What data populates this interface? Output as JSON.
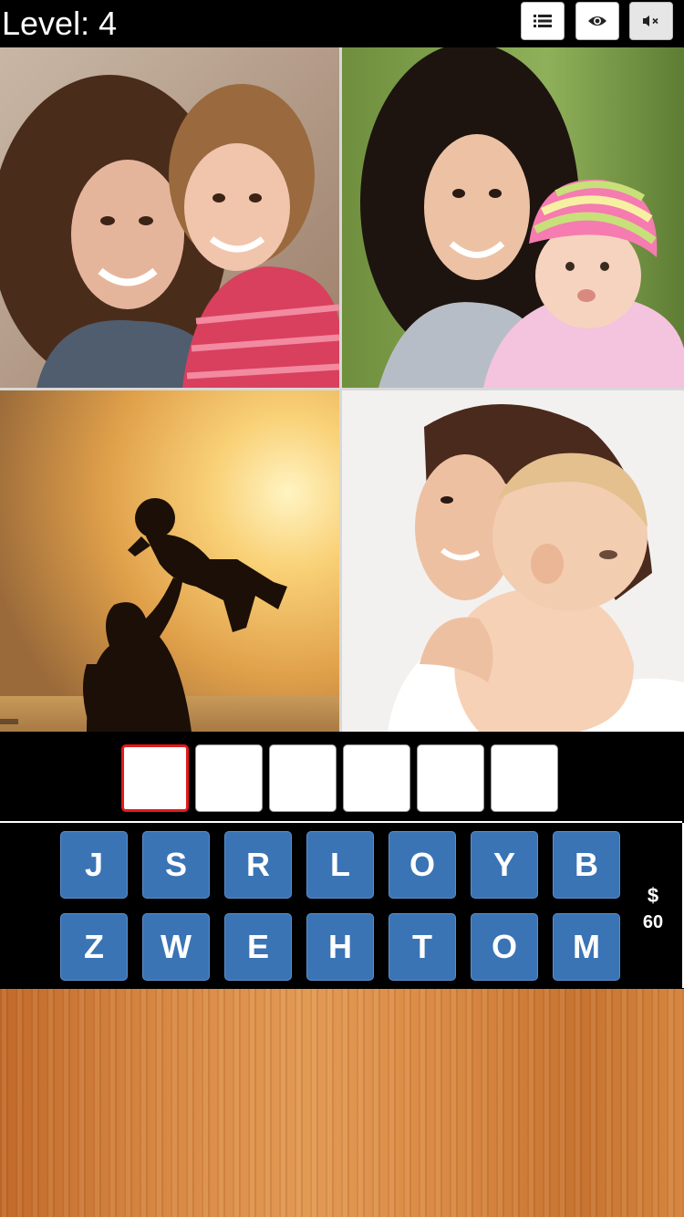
{
  "header": {
    "level_text": "Level: 4",
    "buttons": [
      {
        "name": "menu-list",
        "icon": "list-icon"
      },
      {
        "name": "hint-reveal",
        "icon": "eye-icon"
      },
      {
        "name": "sound-toggle",
        "icon": "speaker-mute-icon"
      }
    ]
  },
  "photos": [
    {
      "name": "photo-mother-daughter",
      "subject": "mother hugging daughter"
    },
    {
      "name": "photo-mother-baby-hat",
      "subject": "mother with baby in striped hat"
    },
    {
      "name": "photo-silhouette-sunset",
      "subject": "silhouette lifting child at sunset"
    },
    {
      "name": "photo-mother-holding-baby",
      "subject": "mother holding baby"
    }
  ],
  "answer": {
    "length": 6,
    "letters": [
      "",
      "",
      "",
      "",
      "",
      ""
    ],
    "active_index": 0
  },
  "keyboard": {
    "rows": [
      [
        "J",
        "S",
        "R",
        "L",
        "O",
        "Y",
        "B"
      ],
      [
        "Z",
        "W",
        "E",
        "H",
        "T",
        "O",
        "M"
      ]
    ]
  },
  "coins": {
    "symbol": "$",
    "amount": "60"
  },
  "colors": {
    "key_blue": "#3a74b5",
    "active_slot_border": "#e3191b",
    "background": "#000000",
    "wood": "#d88a45"
  }
}
